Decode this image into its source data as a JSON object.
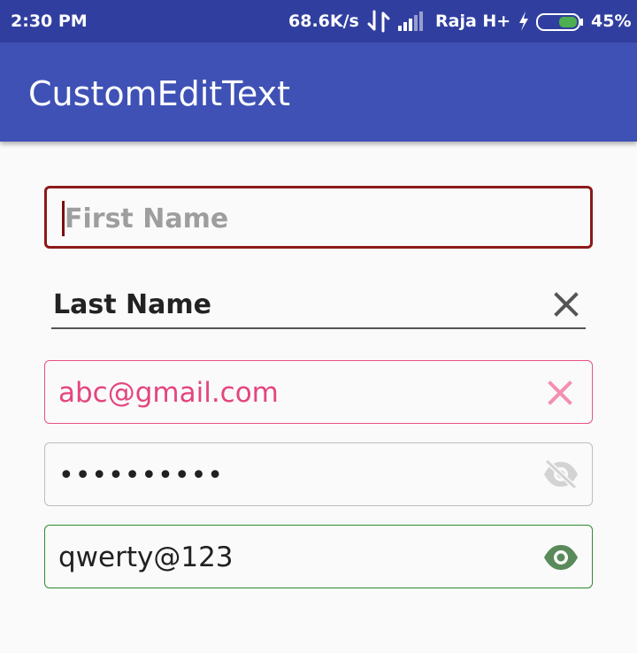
{
  "status_bar": {
    "time": "2:30 PM",
    "speed": "68.6K/s",
    "carrier": "Raja H+",
    "battery": "45%",
    "icons": [
      "data-transfer-icon",
      "signal-icon",
      "charging-bolt-icon",
      "battery-icon"
    ]
  },
  "app_bar": {
    "title": "CustomEditText"
  },
  "fields": {
    "first_name": {
      "placeholder": "First Name",
      "value": "",
      "border_color": "#8b1a1a"
    },
    "last_name": {
      "value": "Last Name",
      "icon": "close-icon"
    },
    "email": {
      "value": "abc@gmail.com",
      "icon": "close-icon",
      "accent_color": "#e8508a"
    },
    "password_hidden": {
      "value": "••••••••••",
      "icon": "eye-off-icon"
    },
    "password_visible": {
      "value": "qwerty@123",
      "icon": "eye-icon",
      "accent_color": "#2e8b2e"
    }
  },
  "colors": {
    "primary": "#3f51b5",
    "primary_dark": "#303f9f",
    "battery_fill": "#4caf50"
  }
}
